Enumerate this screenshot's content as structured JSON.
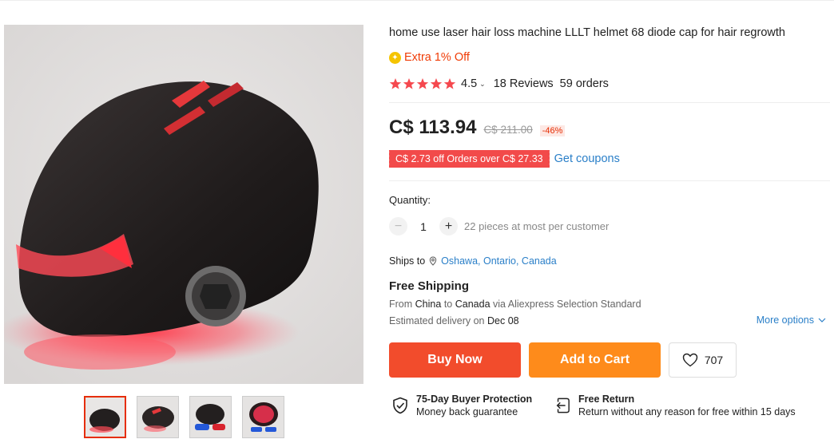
{
  "product": {
    "title": "home use laser hair loss machine LLLT helmet 68 diode cap for hair regrowth",
    "extra_offer": "Extra 1% Off",
    "rating": {
      "stars": 5,
      "score": "4.5",
      "reviews": "18 Reviews",
      "orders": "59 orders"
    },
    "price": "C$ 113.94",
    "original_price": "C$ 211.00",
    "discount": "-46%",
    "coupon": {
      "badge": "C$ 2.73 off Orders over C$ 27.33",
      "link": "Get coupons"
    },
    "quantity": {
      "label": "Quantity:",
      "value": "1",
      "minus": "−",
      "plus": "+",
      "note": "22 pieces at most per customer"
    },
    "shipping": {
      "ships_to_label": "Ships to",
      "location": "Oshawa, Ontario, Canada",
      "title": "Free Shipping",
      "from_label": "From",
      "from_country": "China",
      "to_label": "to",
      "to_country": "Canada",
      "via": "via Aliexpress Selection Standard",
      "estimated_label": "Estimated delivery on",
      "estimated_date": "Dec 08",
      "more_options": "More options"
    },
    "buttons": {
      "buy_now": "Buy Now",
      "add_to_cart": "Add to Cart",
      "wishlist_count": "707"
    },
    "guarantees": [
      {
        "title": "75-Day Buyer Protection",
        "desc": "Money back guarantee"
      },
      {
        "title": "Free Return",
        "desc": "Return without any reason for free within 15 days"
      }
    ]
  },
  "gallery": {
    "thumbnail_count": 4,
    "active_index": 0
  },
  "colors": {
    "accent_red": "#f24c2c",
    "cart_orange": "#fe8b1b",
    "link_blue": "#2a7fc8",
    "star_red": "#f5484e"
  }
}
